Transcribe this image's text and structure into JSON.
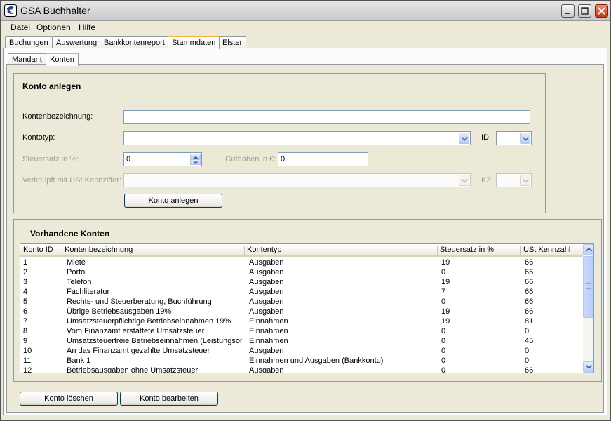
{
  "window": {
    "title": "GSA Buchhalter",
    "app_icon_glyph": "€"
  },
  "menu": [
    "Datei",
    "Optionen",
    "Hilfe"
  ],
  "main_tabs": [
    "Buchungen",
    "Auswertung",
    "Bankkontenreport",
    "Stammdaten",
    "Elster"
  ],
  "main_tabs_active": "Stammdaten",
  "sub_tabs": [
    "Mandant",
    "Konten"
  ],
  "sub_tabs_active": "Konten",
  "form": {
    "group_title": "Konto anlegen",
    "kontenbezeichnung_label": "Kontenbezeichnung:",
    "kontenbezeichnung_value": "",
    "kontotyp_label": "Kontotyp:",
    "kontotyp_value": "",
    "id_label": "ID:",
    "id_value": "",
    "steuersatz_label": "Steuersatz in %:",
    "steuersatz_value": "0",
    "guthaben_label": "Guthaben in €:",
    "guthaben_value": "0",
    "kennziffer_label": "Verknüpft mit USt Kennziffer:",
    "kennziffer_value": "",
    "kz_label": "KZ:",
    "kz_value": "",
    "submit_label": "Konto anlegen"
  },
  "list": {
    "group_title": "Vorhandene Konten",
    "columns": [
      "Konto ID",
      "Kontenbezeichnung",
      "Kontentyp",
      "Steuersatz in %",
      "USt Kennzahl"
    ],
    "rows": [
      [
        "1",
        "Miete",
        "Ausgaben",
        "19",
        "66"
      ],
      [
        "2",
        "Porto",
        "Ausgaben",
        "0",
        "66"
      ],
      [
        "3",
        "Telefon",
        "Ausgaben",
        "19",
        "66"
      ],
      [
        "4",
        "Fachliteratur",
        "Ausgaben",
        "7",
        "66"
      ],
      [
        "5",
        "Rechts- und Steuerberatung, Buchführung",
        "Ausgaben",
        "0",
        "66"
      ],
      [
        "6",
        "Übrige Betriebsausgaben 19%",
        "Ausgaben",
        "19",
        "66"
      ],
      [
        "7",
        "Umsatzsteuerpflichtige Betriebseinnahmen 19%",
        "Einnahmen",
        "19",
        "81"
      ],
      [
        "8",
        "Vom Finanzamt erstattete Umsatzsteuer",
        "Einnahmen",
        "0",
        "0"
      ],
      [
        "9",
        "Umsatzsteuerfreie Betriebseinnahmen (Leistungsor...",
        "Einnahmen",
        "0",
        "45"
      ],
      [
        "10",
        "An das Finanzamt gezahlte Umsatzsteuer",
        "Ausgaben",
        "0",
        "0"
      ],
      [
        "11",
        "Bank 1",
        "Einnahmen und Ausgaben (Bankkonto)",
        "0",
        "0"
      ],
      [
        "12",
        "Betriebsausgaben ohne Umsatzsteuer",
        "Ausgaben",
        "0",
        "66"
      ]
    ]
  },
  "actions": {
    "delete_label": "Konto löschen",
    "edit_label": "Konto bearbeiten"
  }
}
